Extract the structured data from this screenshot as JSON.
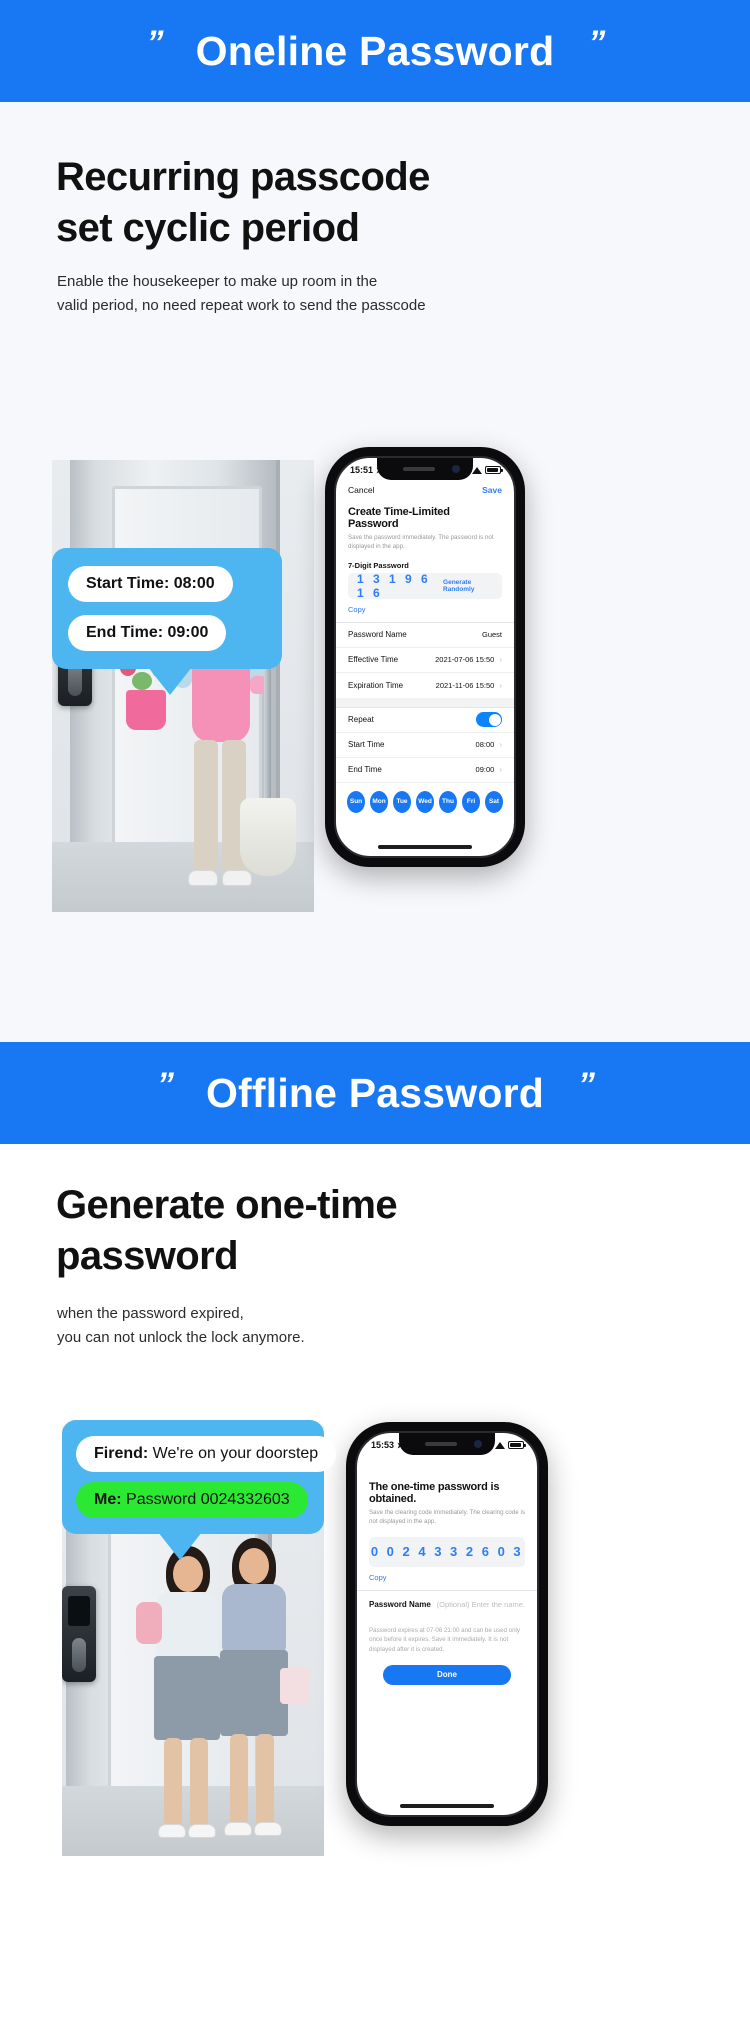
{
  "sections": [
    {
      "banner": {
        "title": "Oneline Password",
        "quote_glyph": "”"
      },
      "headline_line1": "Recurring passcode",
      "headline_line2": "set cyclic period",
      "subcopy_line1": "Enable the housekeeper to make up room in the",
      "subcopy_line2": "valid period, no need repeat work to send the passcode",
      "bubble": {
        "rows": [
          {
            "label": "Start Time:",
            "value": "08:00"
          },
          {
            "label": "End Time:",
            "value": "09:00"
          }
        ]
      },
      "phone": {
        "status": {
          "time": "15:51",
          "location_icon": "location-arrow-icon"
        },
        "nav": {
          "cancel": "Cancel",
          "save": "Save"
        },
        "title": "Create Time-Limited Password",
        "description": "Save the password immediately. The password is not displayed in the app.",
        "password_field_label": "7-Digit Password",
        "password_value": "1 3 1 9 6 1 6",
        "generate_label": "Generate Randomly",
        "copy_label": "Copy",
        "rows": [
          {
            "label": "Password Name",
            "value": "Guest",
            "chevron": ""
          },
          {
            "label": "Effective Time",
            "value": "2021-07-06 15:50",
            "chevron": "›"
          },
          {
            "label": "Expiration Time",
            "value": "2021-11-06 15:50",
            "chevron": "›"
          }
        ],
        "repeat_label": "Repeat",
        "repeat_on": true,
        "time_rows": [
          {
            "label": "Start Time",
            "value": "08:00",
            "chevron": "›"
          },
          {
            "label": "End Time",
            "value": "09:00",
            "chevron": "›"
          }
        ],
        "days": [
          "Sun",
          "Mon",
          "Tue",
          "Wed",
          "Thu",
          "Fri",
          "Sat"
        ]
      }
    },
    {
      "banner": {
        "title": "Offline Password",
        "quote_glyph": "”"
      },
      "headline_line1": "Generate one-time",
      "headline_line2": "password",
      "subcopy_line1": "when the password expired,",
      "subcopy_line2": "you can not unlock the lock anymore.",
      "bubble": {
        "rows": [
          {
            "label": "Firend:",
            "value": "We're on your doorstep"
          },
          {
            "label": "Me:",
            "value": "Password 0024332603"
          }
        ]
      },
      "phone": {
        "status": {
          "time": "15:53",
          "location_icon": "location-arrow-icon"
        },
        "title": "The one-time password is obtained.",
        "description": "Save the clearing code immediately. The clearing code is not displayed in the app.",
        "password_value": "0 0 2 4 3 3 2 6 0 3",
        "copy_label": "Copy",
        "name_row": {
          "label": "Password Name",
          "placeholder": "(Optional) Enter the name."
        },
        "expire_note": "Password expires at 07-06 21:00 and can be used only once before it expires. Save it immediately. It is not displayed after it is created.",
        "done_label": "Done"
      }
    }
  ],
  "colors": {
    "brand_blue": "#1877F2",
    "bubble_blue": "#4DB6F0",
    "link_blue": "#2f7cf6",
    "green_pill": "#2BE832",
    "section_bg": "#F7F8FC"
  }
}
